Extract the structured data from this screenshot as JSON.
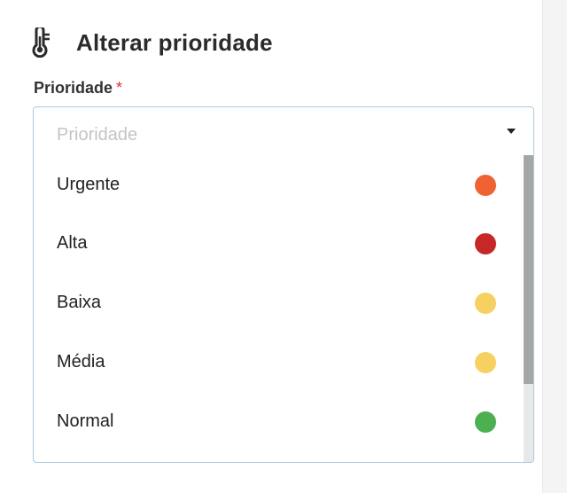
{
  "dialog": {
    "title": "Alterar prioridade",
    "icon": "thermometer-icon"
  },
  "field": {
    "label": "Prioridade",
    "required_mark": "*",
    "placeholder": "Prioridade"
  },
  "options": [
    {
      "label": "Urgente",
      "color": "#ef6233"
    },
    {
      "label": "Alta",
      "color": "#c62828"
    },
    {
      "label": "Baixa",
      "color": "#f6d060"
    },
    {
      "label": "Média",
      "color": "#f6d060"
    },
    {
      "label": "Normal",
      "color": "#4caf50"
    }
  ],
  "colors": {
    "border_focus": "#a9cbe0",
    "required": "#d93030"
  }
}
